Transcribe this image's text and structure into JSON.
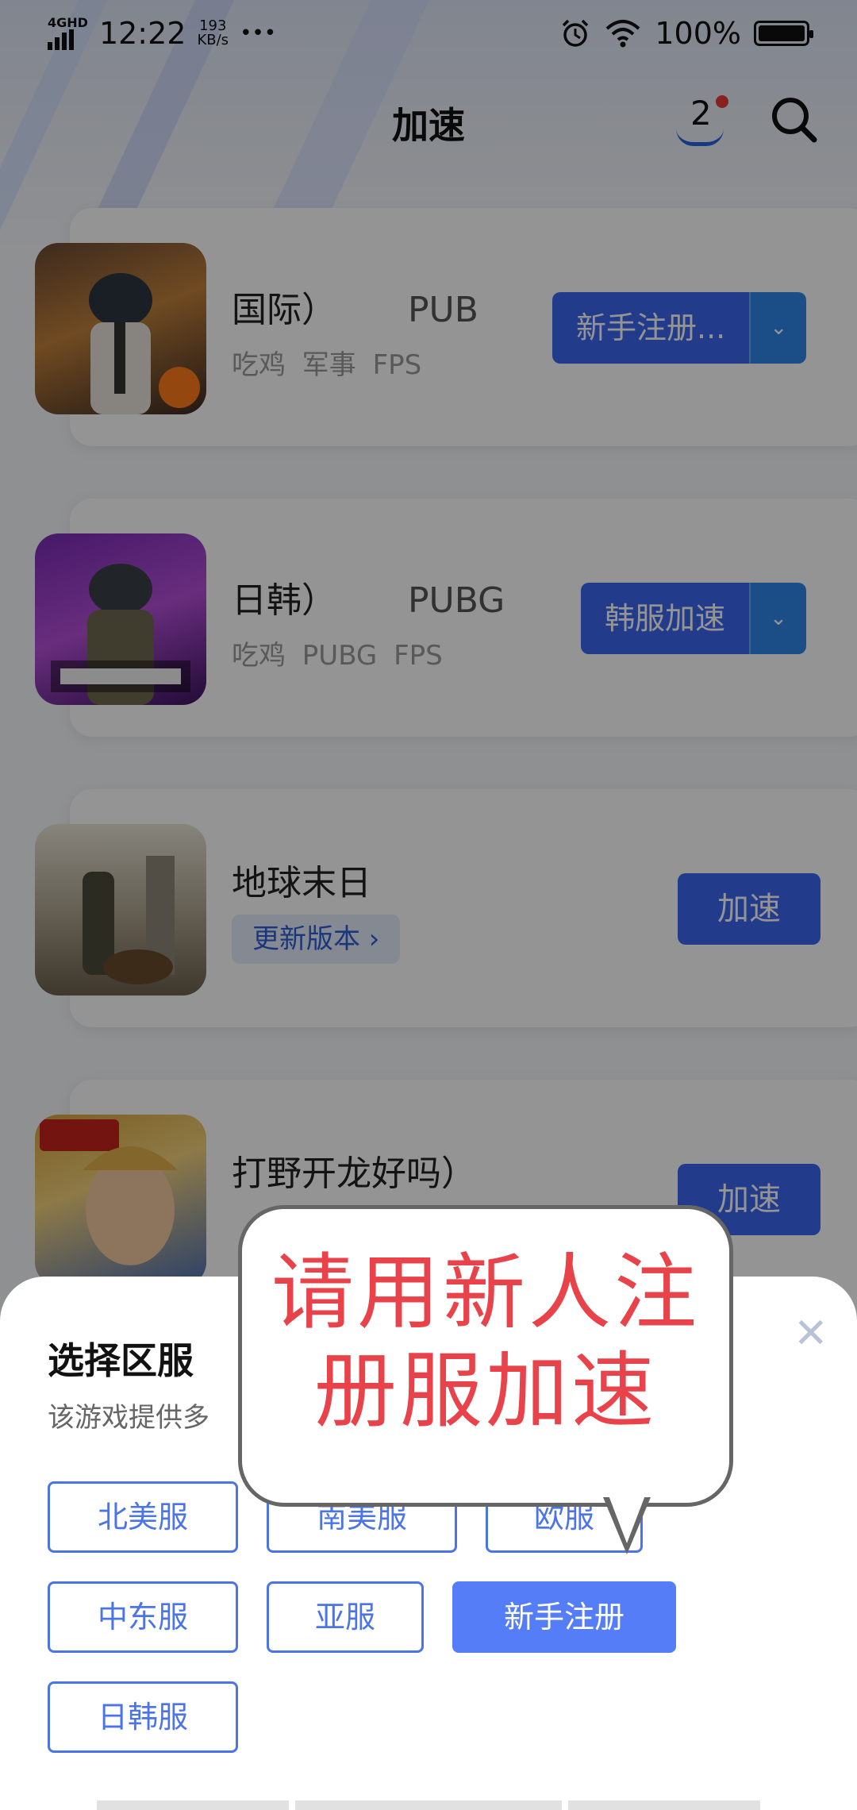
{
  "status_bar": {
    "network": "4GHD",
    "time": "12:22",
    "speed_value": "193",
    "speed_unit": "KB/s",
    "more": "•••",
    "battery": "100%"
  },
  "header": {
    "title": "加速",
    "badge_count": "2"
  },
  "games": [
    {
      "title": "国际）",
      "subtitle": "PUB",
      "tags": "吃鸡 军事 FPS",
      "button": "新手注册...",
      "dropdown": "⌄"
    },
    {
      "title": "日韩）",
      "subtitle": "PUBG",
      "tags": "吃鸡 PUBG FPS",
      "button": "韩服加速",
      "dropdown": "⌄"
    },
    {
      "title": "地球末日",
      "update": "更新版本 ›",
      "button": "加速"
    },
    {
      "title": "打野开龙好吗）",
      "button": "加速"
    }
  ],
  "sheet": {
    "title": "选择区服",
    "subtitle": "该游戏提供多",
    "close": "✕",
    "regions": [
      "北美服",
      "南美服",
      "欧服",
      "中东服",
      "亚服",
      "新手注册",
      "日韩服"
    ]
  },
  "callout": {
    "line1": "请用新人注",
    "line2": "册服加速"
  },
  "colors": {
    "accent": "#3d67f0",
    "selected_region": "#557df7",
    "callout_text": "#e8434b"
  }
}
